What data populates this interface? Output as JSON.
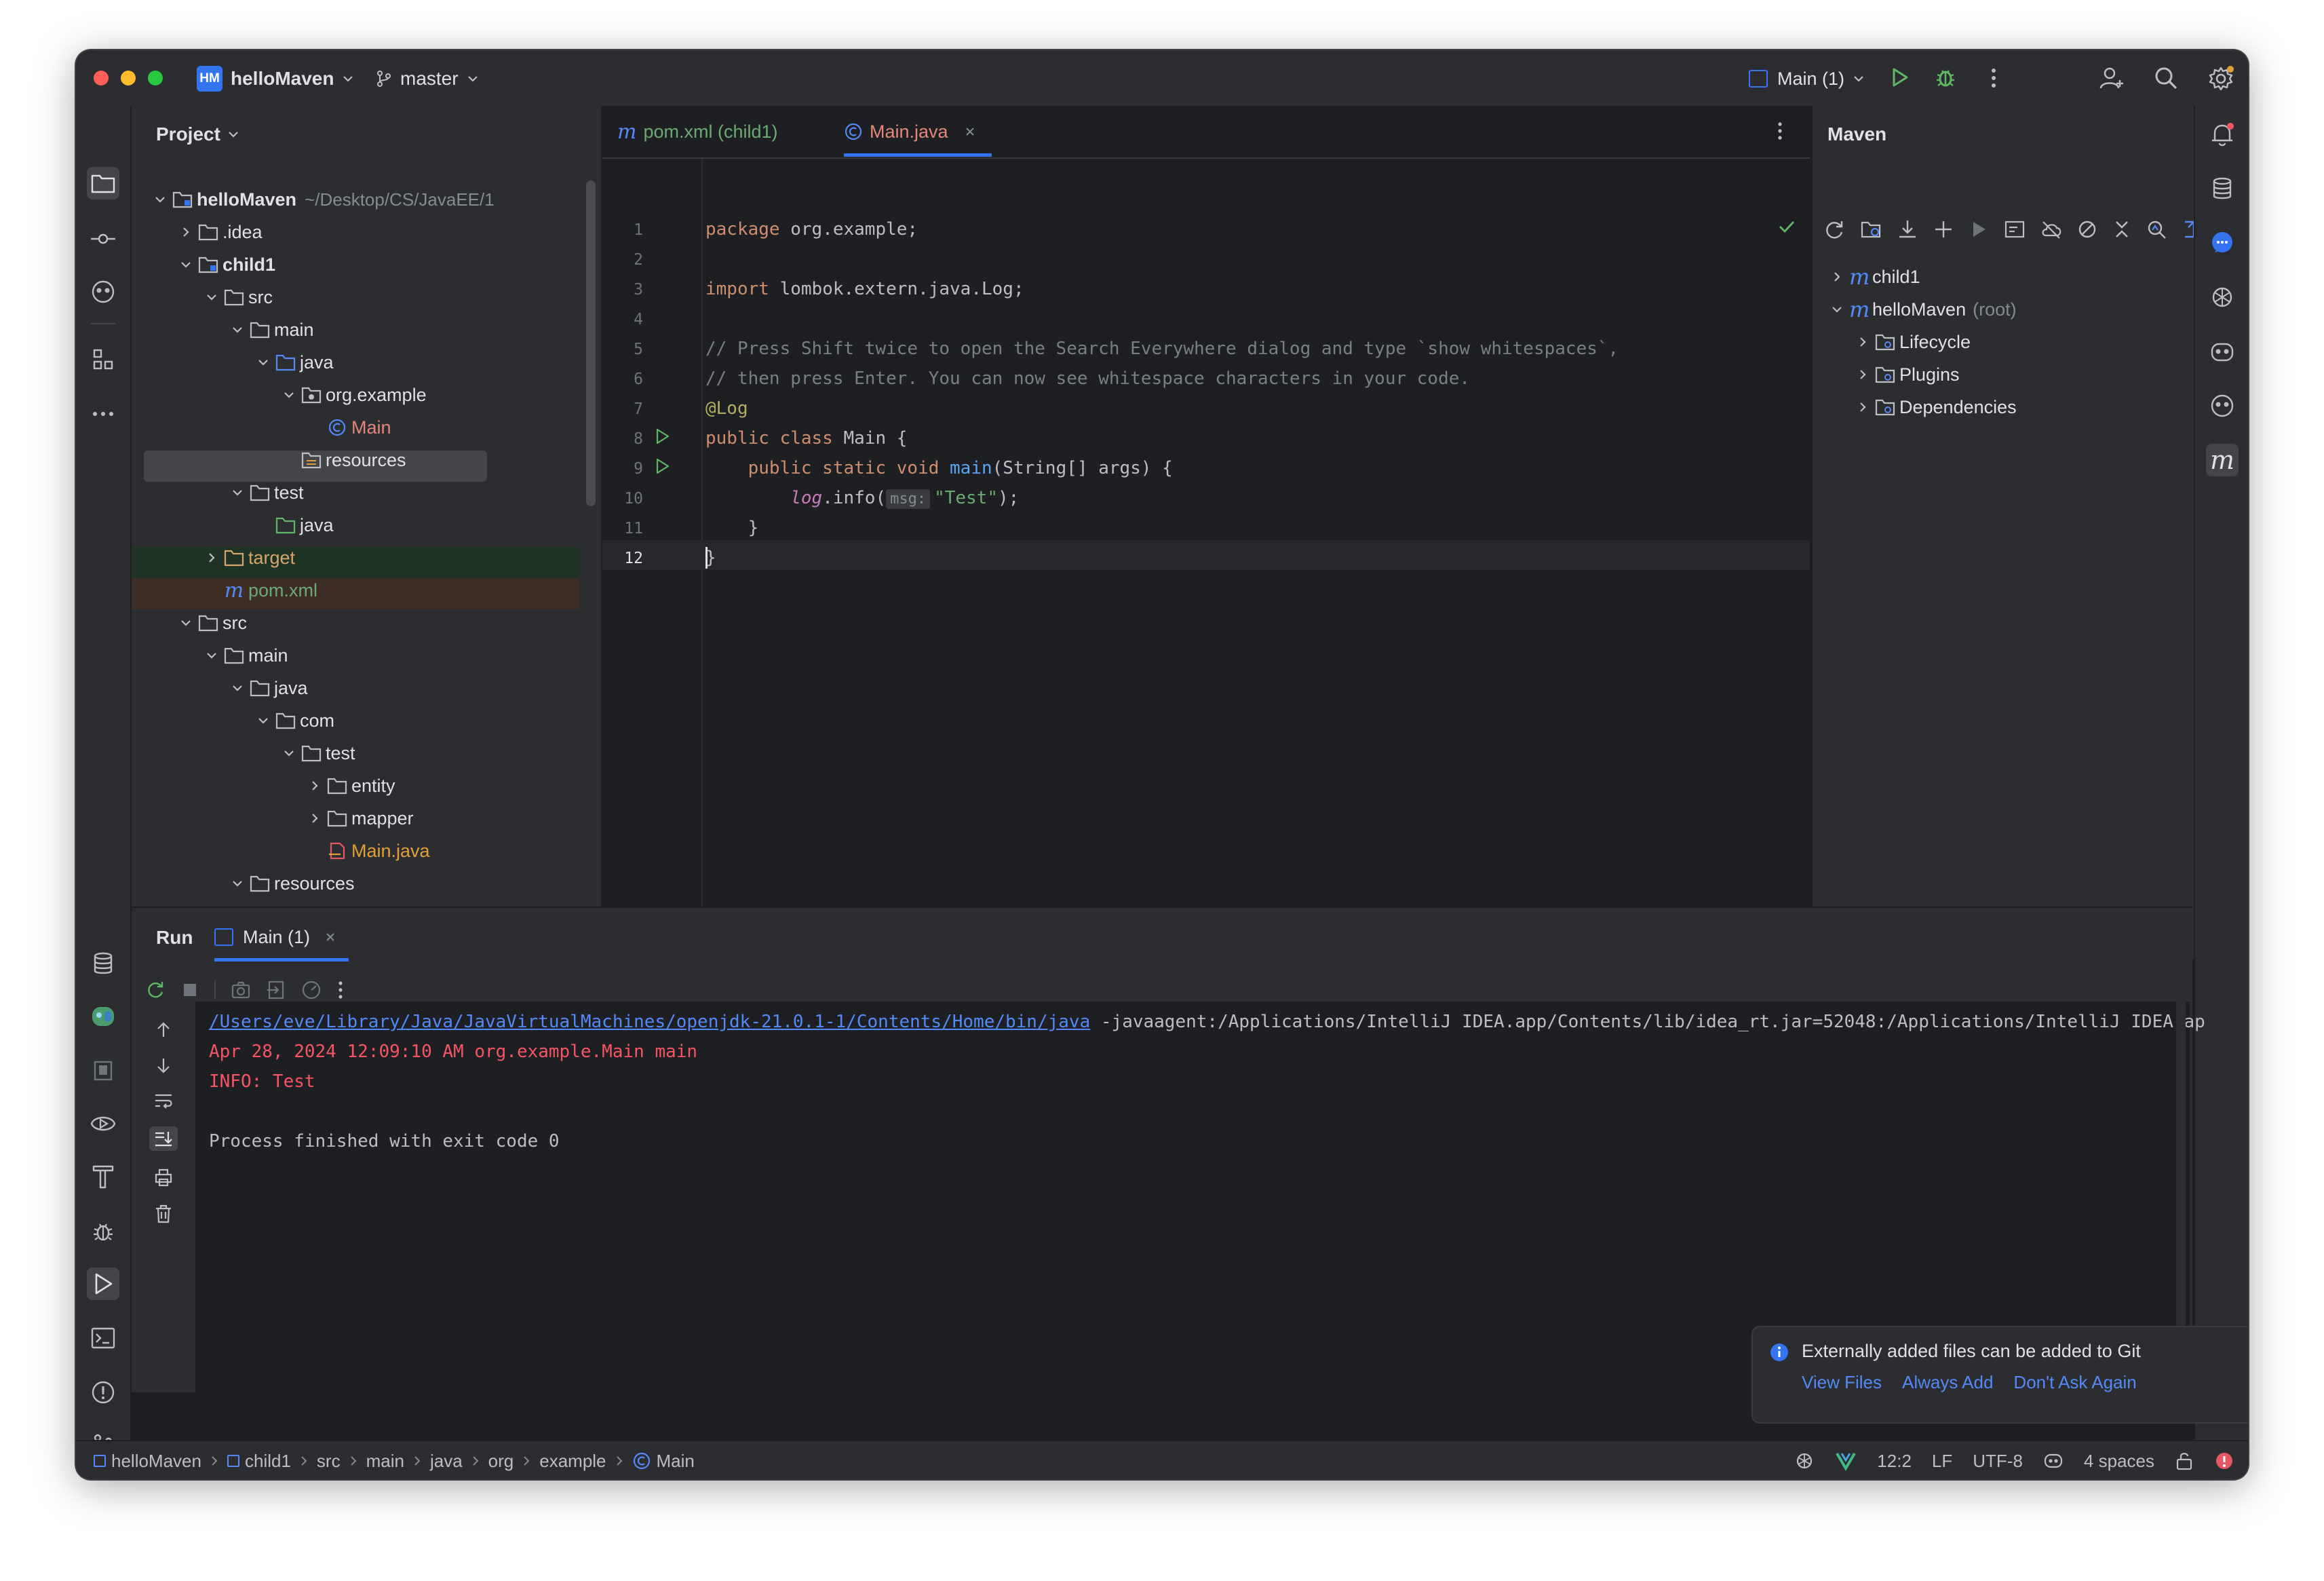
{
  "titlebar": {
    "project_badge": "HM",
    "project_name": "helloMaven",
    "branch": "master",
    "run_config": "Main (1)"
  },
  "project_panel": {
    "title": "Project",
    "root_name": "helloMaven",
    "root_path": "~/Desktop/CS/JavaEE/1",
    "items": [
      {
        "label": ".idea"
      },
      {
        "label": "child1"
      },
      {
        "label": "src"
      },
      {
        "label": "main"
      },
      {
        "label": "java"
      },
      {
        "label": "org.example"
      },
      {
        "label": "Main"
      },
      {
        "label": "resources"
      },
      {
        "label": "test"
      },
      {
        "label": "java"
      },
      {
        "label": "target"
      },
      {
        "label": "pom.xml"
      },
      {
        "label": "src"
      },
      {
        "label": "main"
      },
      {
        "label": "java"
      },
      {
        "label": "com"
      },
      {
        "label": "test"
      },
      {
        "label": "entity"
      },
      {
        "label": "mapper"
      },
      {
        "label": "Main.java"
      },
      {
        "label": "resources"
      }
    ]
  },
  "editor": {
    "tabs": [
      {
        "label": "pom.xml (child1)"
      },
      {
        "label": "Main.java"
      }
    ],
    "lines": [
      {
        "num": "1"
      },
      {
        "num": "2"
      },
      {
        "num": "3"
      },
      {
        "num": "4"
      },
      {
        "num": "5"
      },
      {
        "num": "6"
      },
      {
        "num": "7"
      },
      {
        "num": "8"
      },
      {
        "num": "9"
      },
      {
        "num": "10"
      },
      {
        "num": "11"
      },
      {
        "num": "12"
      }
    ],
    "code": {
      "l1_kw": "package",
      "l1_rest": " org.example;",
      "l3_kw": "import",
      "l3_rest": " lombok.extern.java.Log;",
      "l5": "// Press Shift twice to open the Search Everywhere dialog and type `show whitespaces`,",
      "l6": "// then press Enter. You can now see whitespace characters in your code.",
      "l7": "@Log",
      "l8_kw": "public class",
      "l8_rest": " Main {",
      "l9_kw": "    public static void",
      "l9_fn": " main",
      "l9_rest": "(String[] args) {",
      "l10_a": "        log",
      "l10_b": ".info(",
      "l10_hint": "msg:",
      "l10_str": "\"Test\"",
      "l10_end": ");",
      "l11": "    }",
      "l12": "}"
    }
  },
  "maven": {
    "title": "Maven",
    "items": [
      {
        "label": "child1"
      },
      {
        "label": "helloMaven",
        "suffix": "(root)"
      },
      {
        "label": "Lifecycle"
      },
      {
        "label": "Plugins"
      },
      {
        "label": "Dependencies"
      }
    ]
  },
  "run": {
    "title": "Run",
    "tab_label": "Main (1)",
    "console": {
      "path_link": "/Users/eve/Library/Java/JavaVirtualMachines/openjdk-21.0.1-1/Contents/Home/bin/java",
      "path_rest": " -javaagent:/Applications/IntelliJ IDEA.app/Contents/lib/idea_rt.jar=52048:/Applications/IntelliJ IDEA.ap",
      "log_line1": "Apr 28, 2024 12:09:10 AM org.example.Main main",
      "log_line2": "INFO: Test",
      "exit_line": "Process finished with exit code 0"
    }
  },
  "notification": {
    "message": "Externally added files can be added to Git",
    "actions": [
      "View Files",
      "Always Add",
      "Don't Ask Again"
    ]
  },
  "statusbar": {
    "breadcrumbs": [
      "helloMaven",
      "child1",
      "src",
      "main",
      "java",
      "org",
      "example",
      "Main"
    ],
    "position": "12:2",
    "line_sep": "LF",
    "encoding": "UTF-8",
    "indent": "4 spaces"
  },
  "colors": {
    "accent": "#3574f0",
    "run_green": "#5fb865",
    "error_red": "#f75464",
    "keyword": "#cf8e6d",
    "string": "#6aab73",
    "comment": "#7a7e85",
    "annotation": "#b3ae60",
    "link": "#548af7"
  }
}
